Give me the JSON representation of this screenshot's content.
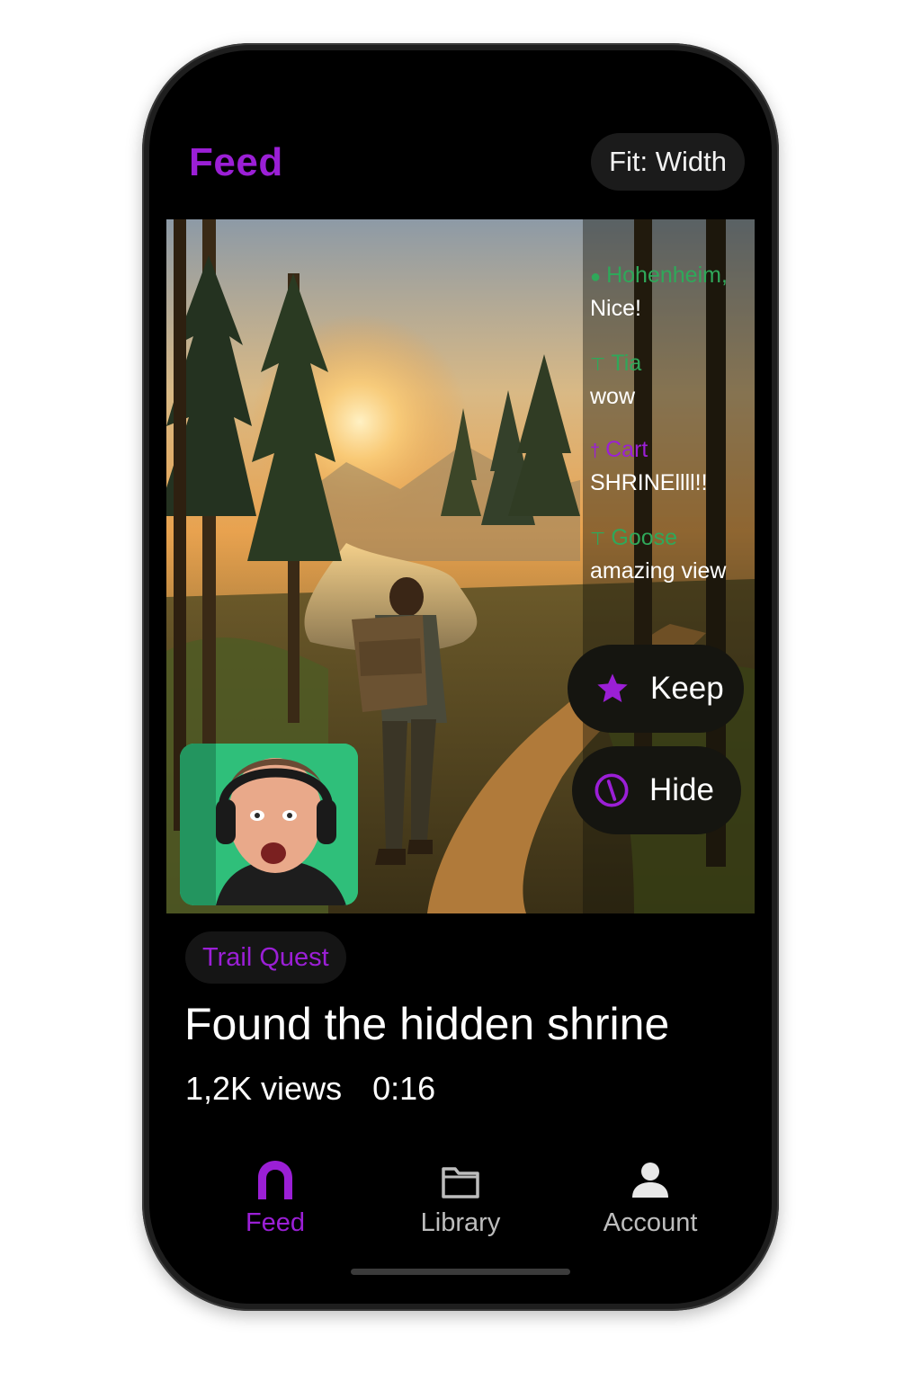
{
  "header": {
    "title": "Feed",
    "fit_label": "Fit: Width"
  },
  "chat": [
    {
      "user": "Hohenheim,",
      "badge": "chat-badge-icon",
      "text": "Nice!",
      "color": "#2fa85a"
    },
    {
      "user": "Tia",
      "badge": "pickaxe-badge-icon",
      "text": "wow",
      "color": "#2fa85a"
    },
    {
      "user": "Cart",
      "badge": "sword-badge-icon",
      "text": "SHRINEllll!!",
      "color": "#9b1fd6"
    },
    {
      "user": "Goose",
      "badge": "pickaxe-badge-icon",
      "text": "amazing view",
      "color": "#2fa85a"
    }
  ],
  "actions": {
    "keep_label": "Keep",
    "keep_icon": "star-icon",
    "hide_label": "Hide",
    "hide_icon": "hide-icon"
  },
  "video": {
    "tag": "Trail Quest",
    "title": "Found the hidden shrine",
    "views": "1,2K views",
    "duration": "0:16"
  },
  "nav": {
    "items": [
      {
        "label": "Feed",
        "icon": "feed-arch-icon",
        "active": true
      },
      {
        "label": "Library",
        "icon": "folder-icon",
        "active": false
      },
      {
        "label": "Account",
        "icon": "person-icon",
        "active": false
      }
    ]
  },
  "colors": {
    "accent": "#9b1fd6",
    "background": "#000000",
    "chat_green": "#2fa85a",
    "inactive_nav": "#bdbdbd"
  }
}
